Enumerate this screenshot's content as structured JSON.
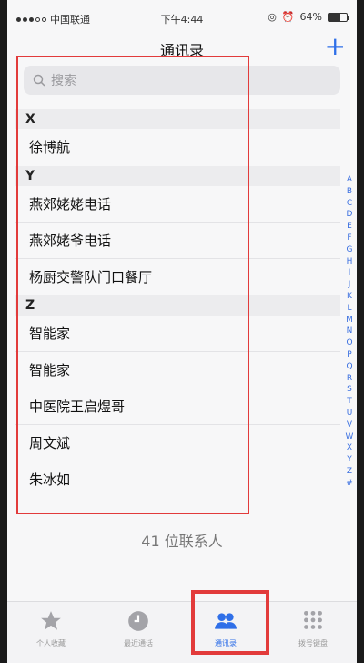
{
  "status": {
    "carrier": "中国联通",
    "time": "下午4:44",
    "battery": "64%",
    "battery_level": 0.64
  },
  "nav": {
    "title": "通讯录",
    "add_label": "+"
  },
  "search": {
    "placeholder": "搜索"
  },
  "sections": [
    {
      "letter": "X",
      "contacts": [
        "徐博航"
      ]
    },
    {
      "letter": "Y",
      "contacts": [
        "燕郊姥姥电话",
        "燕郊姥爷电话",
        "杨厨交警队门口餐厅"
      ]
    },
    {
      "letter": "Z",
      "contacts": [
        "智能家",
        "智能家",
        "中医院王启煜哥",
        "周文斌",
        "朱冰如"
      ]
    }
  ],
  "index_letters": [
    "A",
    "B",
    "C",
    "D",
    "E",
    "F",
    "G",
    "H",
    "I",
    "J",
    "K",
    "L",
    "M",
    "N",
    "O",
    "P",
    "Q",
    "R",
    "S",
    "T",
    "U",
    "V",
    "W",
    "X",
    "Y",
    "Z",
    "#"
  ],
  "contact_count": "41 位联系人",
  "tabs": [
    {
      "label": "个人收藏",
      "icon": "star-icon"
    },
    {
      "label": "最近通话",
      "icon": "clock-icon"
    },
    {
      "label": "通讯录",
      "icon": "contacts-icon",
      "active": true
    },
    {
      "label": "拨号键盘",
      "icon": "keypad-icon"
    }
  ],
  "colors": {
    "accent": "#2f6fe8",
    "highlight": "#e23b3b"
  }
}
